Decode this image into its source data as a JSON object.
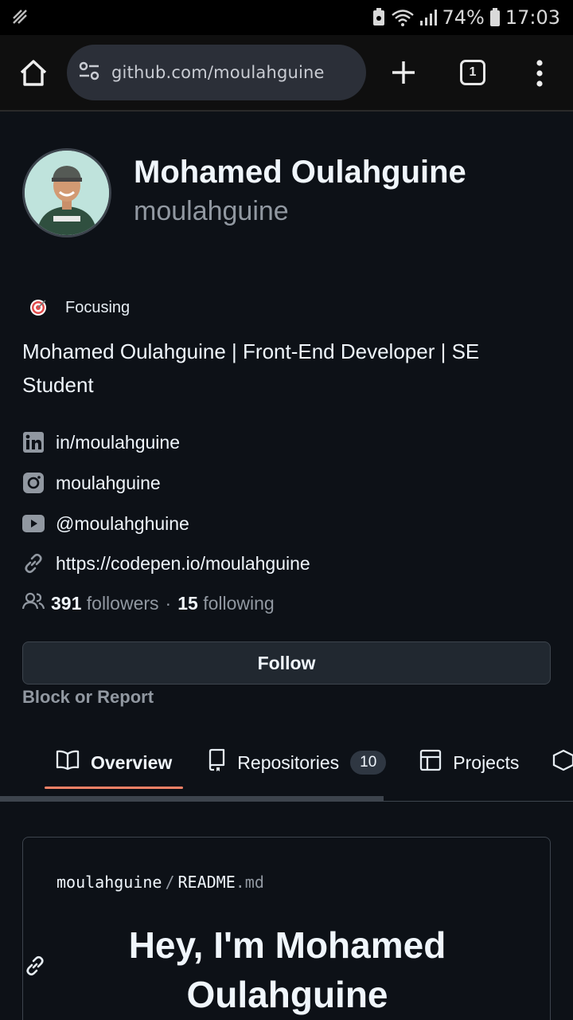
{
  "status_bar": {
    "battery": "74%",
    "time": "17:03"
  },
  "browser": {
    "url": "github.com/moulahguine",
    "tab_count": "1"
  },
  "profile": {
    "full_name": "Mohamed Oulahguine",
    "username": "moulahguine",
    "status_text": "Focusing",
    "bio": "Mohamed Oulahguine | Front-End Developer | SE Student",
    "links": [
      {
        "icon": "linkedin-icon",
        "text": "in/moulahguine"
      },
      {
        "icon": "instagram-icon",
        "text": "moulahguine"
      },
      {
        "icon": "youtube-icon",
        "text": "@moulahghuine"
      },
      {
        "icon": "link-icon",
        "text": "https://codepen.io/moulahguine"
      }
    ],
    "followers_count": "391",
    "followers_label": "followers",
    "separator": "·",
    "following_count": "15",
    "following_label": "following",
    "follow_button": "Follow",
    "block_report": "Block or Report"
  },
  "tabs": [
    {
      "label": "Overview",
      "icon": "book-icon",
      "active": true
    },
    {
      "label": "Repositories",
      "icon": "repo-icon",
      "count": "10"
    },
    {
      "label": "Projects",
      "icon": "table-icon"
    }
  ],
  "readme": {
    "owner": "moulahguine",
    "sep": "/",
    "file": "README",
    "ext": ".md",
    "heading_line1": "Hey, I'm Mohamed",
    "heading_line2": "Oulahguine"
  },
  "colors": {
    "background": "#0d1117",
    "accent_underline": "#f78166",
    "button_bg": "#212830",
    "muted": "#9198a1"
  }
}
